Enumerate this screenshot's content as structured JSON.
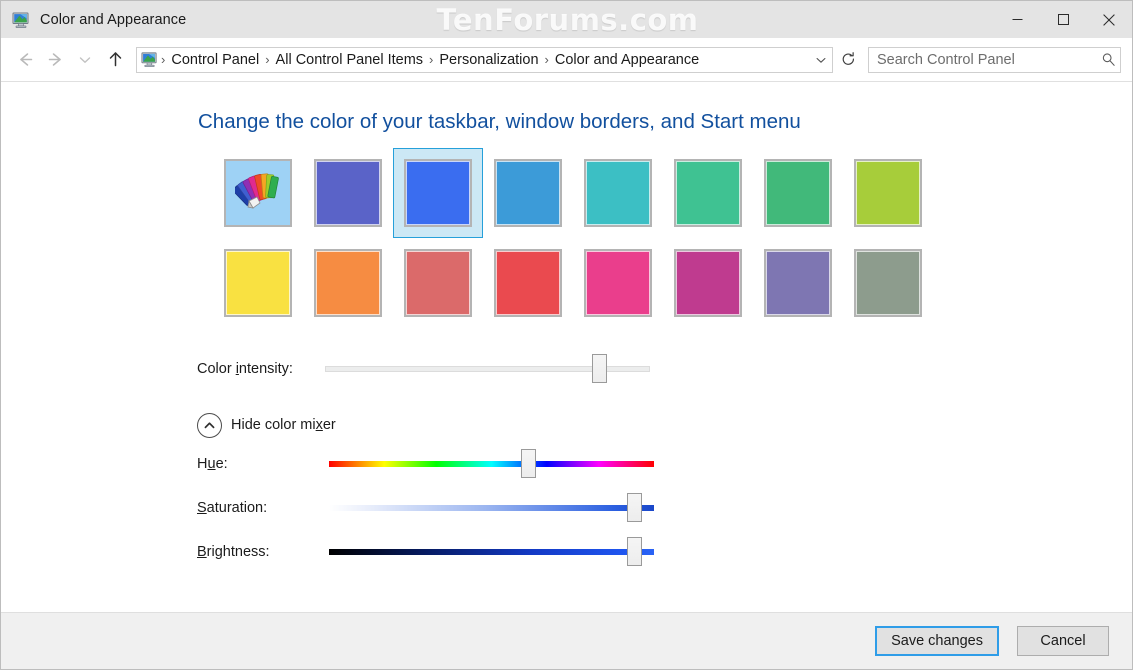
{
  "window": {
    "title": "Color and Appearance",
    "icon": "display-monitor-icon",
    "minimize_label": "Minimize",
    "maximize_label": "Maximize",
    "close_label": "Close"
  },
  "watermark": {
    "text": "TenForums.com"
  },
  "nav": {
    "back_label": "Back",
    "forward_label": "Forward",
    "recent_label": "Recent locations",
    "up_label": "Up one level",
    "refresh_label": "Refresh",
    "dropdown_label": "Previous locations",
    "breadcrumbs": [
      "Control Panel",
      "All Control Panel Items",
      "Personalization",
      "Color and Appearance"
    ],
    "separator": "›"
  },
  "search": {
    "placeholder": "Search Control Panel",
    "value": "",
    "icon": "search-icon"
  },
  "main": {
    "heading": "Change the color of your taskbar, window borders, and Start menu",
    "custom_color_label": "Custom color",
    "swatches": [
      [
        {
          "name": "custom-color",
          "color": "#9ed2f5",
          "custom": true,
          "selected": false
        },
        {
          "name": "indigo",
          "color": "#5a63c8",
          "custom": false,
          "selected": false
        },
        {
          "name": "blue",
          "color": "#3a6df0",
          "custom": false,
          "selected": true
        },
        {
          "name": "sky-blue",
          "color": "#3c9bd8",
          "custom": false,
          "selected": false
        },
        {
          "name": "teal",
          "color": "#3cbfc4",
          "custom": false,
          "selected": false
        },
        {
          "name": "green-teal",
          "color": "#3fc292",
          "custom": false,
          "selected": false
        },
        {
          "name": "green",
          "color": "#41b97a",
          "custom": false,
          "selected": false
        },
        {
          "name": "lime",
          "color": "#a7cd3a",
          "custom": false,
          "selected": false
        }
      ],
      [
        {
          "name": "yellow",
          "color": "#f9e141",
          "custom": false,
          "selected": false
        },
        {
          "name": "orange",
          "color": "#f68c42",
          "custom": false,
          "selected": false
        },
        {
          "name": "salmon",
          "color": "#db6a6a",
          "custom": false,
          "selected": false
        },
        {
          "name": "red",
          "color": "#ea4a4f",
          "custom": false,
          "selected": false
        },
        {
          "name": "pink",
          "color": "#ea3e8c",
          "custom": false,
          "selected": false
        },
        {
          "name": "magenta",
          "color": "#bf3b8f",
          "custom": false,
          "selected": false
        },
        {
          "name": "purple-grey",
          "color": "#7e76b2",
          "custom": false,
          "selected": false
        },
        {
          "name": "sage-grey",
          "color": "#8d9c8d",
          "custom": false,
          "selected": false
        }
      ]
    ],
    "intensity": {
      "label_before": "Color ",
      "label_accel": "i",
      "label_after": "ntensity:",
      "value_percent": 86
    },
    "mixer_toggle": {
      "label_before": "Hide color mi",
      "label_accel": "x",
      "label_after": "er",
      "icon": "chevron-up-circle-icon",
      "state": "expanded"
    },
    "mixer": [
      {
        "name": "hue",
        "label_before": "H",
        "label_accel": "u",
        "label_after": "e:",
        "value_percent": 62,
        "gradient": "linear-gradient(to right, #ff0000 0%, #ffff00 17%, #00ff00 33%, #00ffff 50%, #0000ff 67%, #ff00ff 83%, #ff0000 100%)"
      },
      {
        "name": "saturation",
        "label_before": "",
        "label_accel": "S",
        "label_after": "aturation:",
        "value_percent": 96,
        "gradient": "linear-gradient(to right, #ffffff 0%, #e9eefb 12%, #9cb6f0 48%, #2b5fe0 88%, #1a47c9 100%)"
      },
      {
        "name": "brightness",
        "label_before": "",
        "label_accel": "B",
        "label_after": "rightness:",
        "value_percent": 96,
        "gradient": "linear-gradient(to right, #000000 0%, #061b63 30%, #1339c4 62%, #1f55ef 90%, #2a63f5 100%)"
      }
    ]
  },
  "footer": {
    "save_label": "Save changes",
    "cancel_label": "Cancel"
  }
}
